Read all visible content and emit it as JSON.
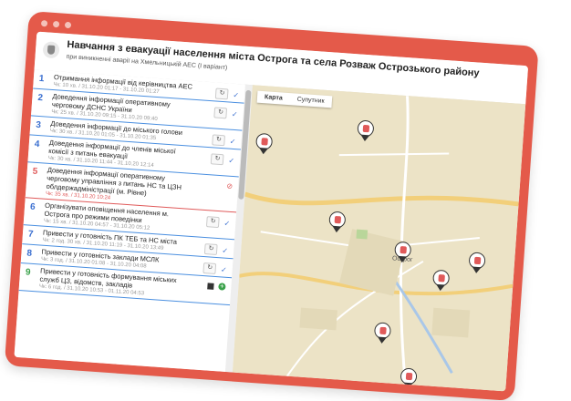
{
  "header": {
    "title": "Навчання з евакуації населення міста Острога та села Розваж Острозького району",
    "subtitle": "при виникненні аварії на Хмельницькій АЕС (I варіант)"
  },
  "map": {
    "tabs": [
      "Карта",
      "Супутник"
    ],
    "city_label": "Острог"
  },
  "tasks": [
    {
      "num": "1",
      "name": "Отримання інформації від керівництва АЕС",
      "meta": "Чк: 10 хв. / 31.10.20 01:17 - 31.10.20 01:27",
      "state": "done"
    },
    {
      "num": "2",
      "name": "Доведення інформації оперативному черговому ДСНС України",
      "meta": "Чк: 25 хв. / 31.10.20 09:15 - 31.10.20 09:40",
      "state": "done"
    },
    {
      "num": "3",
      "name": "Доведення інформації до міського голови",
      "meta": "Чк: 30 хв. / 31.10.20 01:05 - 31.10.20 01:35",
      "state": "done"
    },
    {
      "num": "4",
      "name": "Доведення інформації до членів міської комісії з питань евакуації",
      "meta": "Чк: 30 хв. / 31.10.20 11:44 - 31.10.20 12:14",
      "state": "done"
    },
    {
      "num": "5",
      "name": "Доведення інформації оперативному черговому управління з питань НС та ЦЗН облдержадміністрації (м. Рівне)",
      "meta": "Чк: 35 хв. / 31.10.20 10:24",
      "state": "error"
    },
    {
      "num": "6",
      "name": "Організувати оповіщення населення м. Острога про режими поведінки",
      "meta": "Чк: 15 хв. / 31.10.20 04:57 - 31.10.20 05:12",
      "state": "done"
    },
    {
      "num": "7",
      "name": "Привести у готовність ПК ТЕБ та НС міста",
      "meta": "Чк: 2 год. 30 хв. / 31.10.20 11:19 - 31.10.20 13:49",
      "state": "done"
    },
    {
      "num": "8",
      "name": "Привести у готовність заклади МСЛК",
      "meta": "Чк: 3 год. / 31.10.20 01:08 - 31.10.20 04:08",
      "state": "done"
    },
    {
      "num": "9",
      "name": "Привести у готовність формування міських служб ЦЗ, відомств, закладів",
      "meta": "Чк: 6 год. / 31.10.20 10:53 - 01.11.20 04:53",
      "state": "pending"
    }
  ]
}
